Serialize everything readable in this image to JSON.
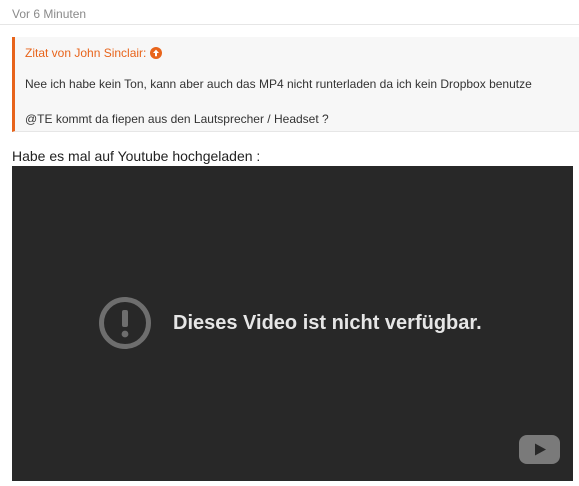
{
  "post": {
    "timestamp": "Vor 6 Minuten",
    "quote": {
      "header": "Zitat von John Sinclair:",
      "header_icon": "arrow-up-circle-icon",
      "line1": "Nee ich habe kein Ton, kann aber auch das MP4 nicht runterladen da ich kein Dropbox benutze",
      "line2": "@TE kommt da fiepen aus den Lautsprecher / Headset ?"
    },
    "body_text": "Habe es mal auf Youtube hochgeladen :",
    "video": {
      "message": "Dieses Video ist nicht verfügbar.",
      "status_icon": "alert-circle-icon",
      "logo_icon": "youtube-logo-icon"
    }
  },
  "colors": {
    "accent": "#e8641b",
    "video_bg": "#282828",
    "quote_bg": "#f7f7f7"
  }
}
